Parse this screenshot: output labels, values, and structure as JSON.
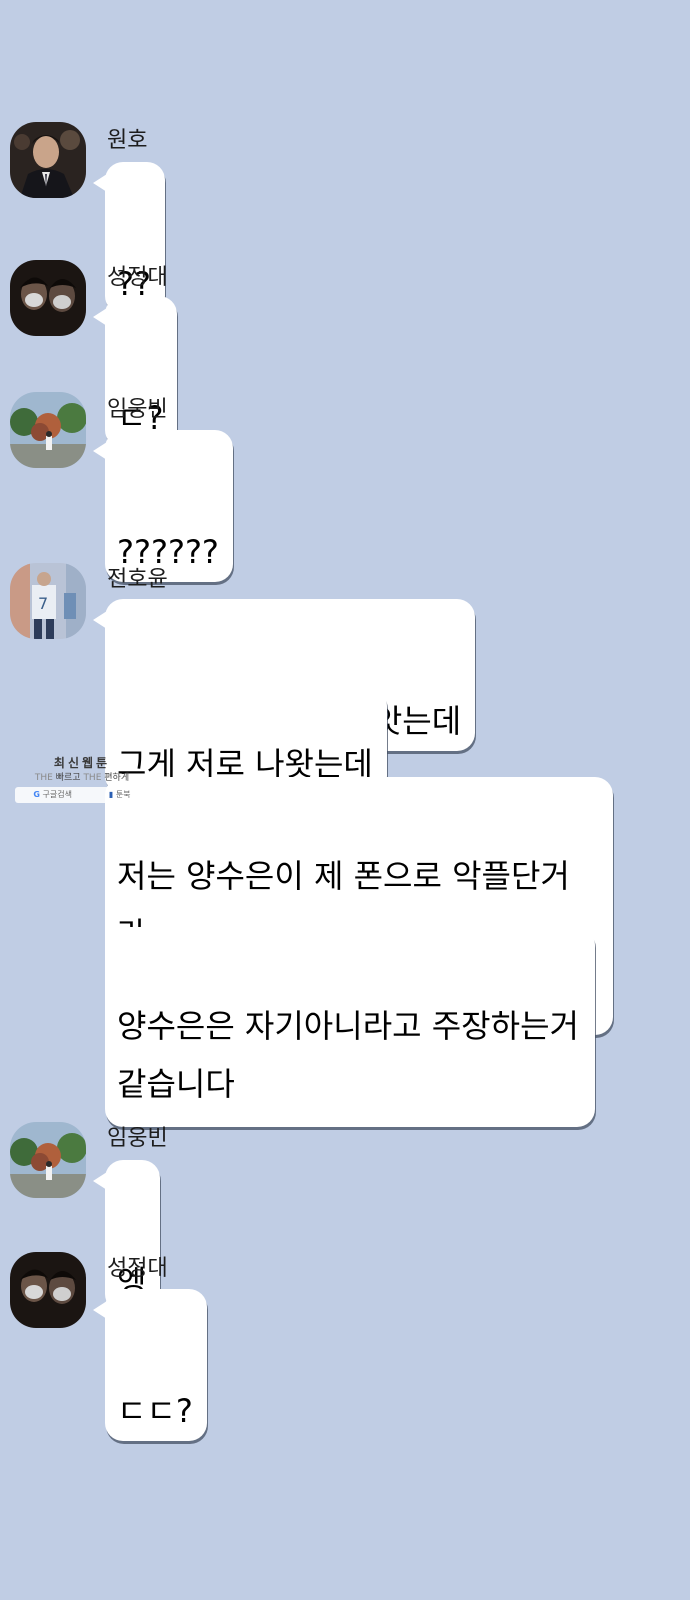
{
  "messages": [
    {
      "sender": "원호",
      "avatar_icon": "profile-photo-suit-icon",
      "lines": [
        "??"
      ]
    },
    {
      "sender": "성정대",
      "avatar_icon": "profile-photo-masked-couple-icon",
      "lines": [
        "ㄷ?"
      ]
    },
    {
      "sender": "임웅빈",
      "avatar_icon": "profile-photo-trees-icon",
      "lines": [
        "??????"
      ]
    },
    {
      "sender": "전호윤",
      "avatar_icon": "profile-photo-soccer-icon",
      "lines": [
        "보배가 악플러를 잡앗는데",
        "그게 저로 나왓는데",
        "저는 양수은이 제 폰으로 악플단거라\n사실대로 말햇고",
        "양수은은 자기아니라고 주장하는거\n같습니다"
      ]
    },
    {
      "sender": "임웅빈",
      "avatar_icon": "profile-photo-trees-icon",
      "lines": [
        "엥"
      ]
    },
    {
      "sender": "성정대",
      "avatar_icon": "profile-photo-masked-couple-icon",
      "lines": [
        "ㄷㄷ?"
      ]
    }
  ],
  "watermark": {
    "title": "최신웹툰",
    "sub_a": "THE",
    "sub_b": "빠르고",
    "sub_c": "THE",
    "sub_d": "편하게",
    "google_label": "구글검색",
    "bookmark_label": "툰북"
  },
  "colors": {
    "background": "#c0cde4",
    "bubble": "#ffffff",
    "bubble_shadow": "#465064"
  }
}
